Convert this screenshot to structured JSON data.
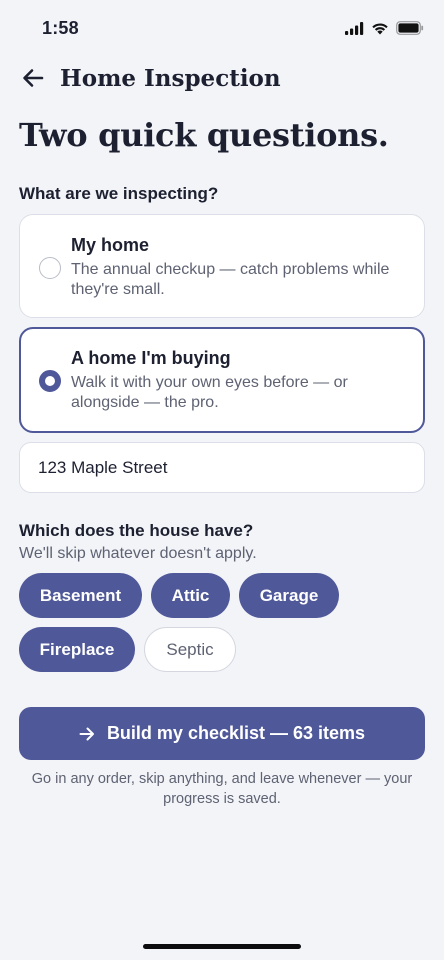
{
  "status_bar": {
    "time": "1:58",
    "icons": [
      "signal-icon",
      "wifi-icon",
      "battery-icon"
    ]
  },
  "header": {
    "back_icon": "arrow-left-icon",
    "title": "Home Inspection"
  },
  "page_title": "Two quick questions.",
  "question_1": {
    "label": "What are we inspecting?",
    "options": [
      {
        "title": "My home",
        "description": "The annual checkup — catch problems while they're small.",
        "selected": false
      },
      {
        "title": "A home I'm buying",
        "description": "Walk it with your own eyes before — or alongside — the pro.",
        "selected": true
      }
    ],
    "address_value": "123 Maple Street"
  },
  "question_2": {
    "label": "Which does the house have?",
    "sublabel": "We'll skip whatever doesn't apply.",
    "chips": [
      {
        "label": "Basement",
        "selected": true
      },
      {
        "label": "Attic",
        "selected": true
      },
      {
        "label": "Garage",
        "selected": true
      },
      {
        "label": "Fireplace",
        "selected": true
      },
      {
        "label": "Septic",
        "selected": false
      }
    ]
  },
  "cta": {
    "icon": "arrow-right-icon",
    "label": "Build my checklist — 63 items"
  },
  "footnote": "Go in any order, skip anything, and leave whenever — your progress is saved.",
  "colors": {
    "accent": "#4f5899",
    "background": "#f3f4f8",
    "text": "#1d2030",
    "muted": "#5e6272"
  }
}
